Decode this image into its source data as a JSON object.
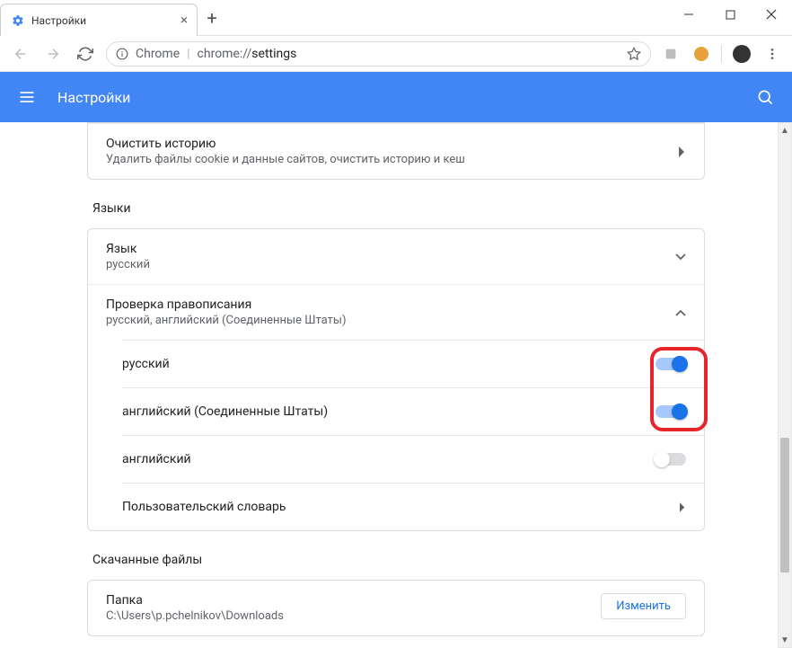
{
  "window": {
    "tab_title": "Настройки",
    "chrome_label": "Chrome",
    "url": "chrome://settings"
  },
  "header": {
    "title": "Настройки"
  },
  "clear_history": {
    "title": "Очистить историю",
    "subtitle": "Удалить файлы cookie и данные сайтов, очистить историю и кеш"
  },
  "sections": {
    "languages_title": "Языки",
    "language_row": {
      "title": "Язык",
      "value": "русский"
    },
    "spellcheck_row": {
      "title": "Проверка правописания",
      "value": "русский, английский (Соединенные Штаты)"
    },
    "spell_items": [
      {
        "label": "русский",
        "on": true
      },
      {
        "label": "английский (Соединенные Штаты)",
        "on": true
      },
      {
        "label": "английский",
        "on": false
      }
    ],
    "custom_dict": "Пользовательский словарь",
    "downloads_title": "Скачанные файлы",
    "folder_label": "Папка",
    "folder_path": "C:\\Users\\p.pchelnikov\\Downloads",
    "change_btn": "Изменить"
  }
}
